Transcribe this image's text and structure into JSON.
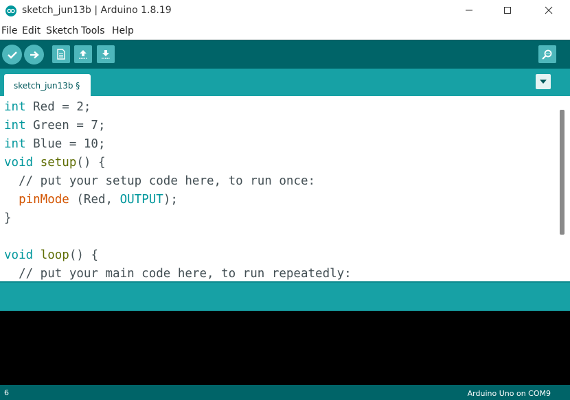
{
  "window": {
    "title": "sketch_jun13b | Arduino 1.8.19"
  },
  "menu": {
    "items": [
      "File",
      "Edit",
      "Sketch",
      "Tools",
      "Help"
    ]
  },
  "toolbar": {
    "buttons": [
      "verify-icon",
      "upload-icon",
      "new-icon",
      "open-icon",
      "save-icon"
    ],
    "right": "serial-monitor-icon"
  },
  "tabs": [
    {
      "label": "sketch_jun13b §"
    }
  ],
  "code": {
    "lines": [
      [
        {
          "t": "int",
          "c": "kw"
        },
        {
          "t": " Red = 2;",
          "c": ""
        }
      ],
      [
        {
          "t": "int",
          "c": "kw"
        },
        {
          "t": " Green = 7;",
          "c": ""
        }
      ],
      [
        {
          "t": "int",
          "c": "kw"
        },
        {
          "t": " Blue = 10;",
          "c": ""
        }
      ],
      [
        {
          "t": "void",
          "c": "kw"
        },
        {
          "t": " ",
          "c": ""
        },
        {
          "t": "setup",
          "c": "fn"
        },
        {
          "t": "() {",
          "c": ""
        }
      ],
      [
        {
          "t": "  // put your setup code here, to run once:",
          "c": "comment"
        }
      ],
      [
        {
          "t": "  ",
          "c": ""
        },
        {
          "t": "pinMode",
          "c": "fn2"
        },
        {
          "t": " (Red, ",
          "c": ""
        },
        {
          "t": "OUTPUT",
          "c": "const"
        },
        {
          "t": ");",
          "c": ""
        }
      ],
      [
        {
          "t": "}",
          "c": ""
        }
      ],
      [
        {
          "t": "",
          "c": ""
        }
      ],
      [
        {
          "t": "void",
          "c": "kw"
        },
        {
          "t": " ",
          "c": ""
        },
        {
          "t": "loop",
          "c": "fn"
        },
        {
          "t": "() {",
          "c": ""
        }
      ],
      [
        {
          "t": "  // put your main code here, to run repeatedly:",
          "c": "comment"
        }
      ]
    ]
  },
  "status": {
    "line": "6",
    "board": "Arduino Uno on COM9"
  },
  "colors": {
    "toolbar": "#006468",
    "tabbar": "#17a1a5",
    "button": "#4db7bb"
  }
}
